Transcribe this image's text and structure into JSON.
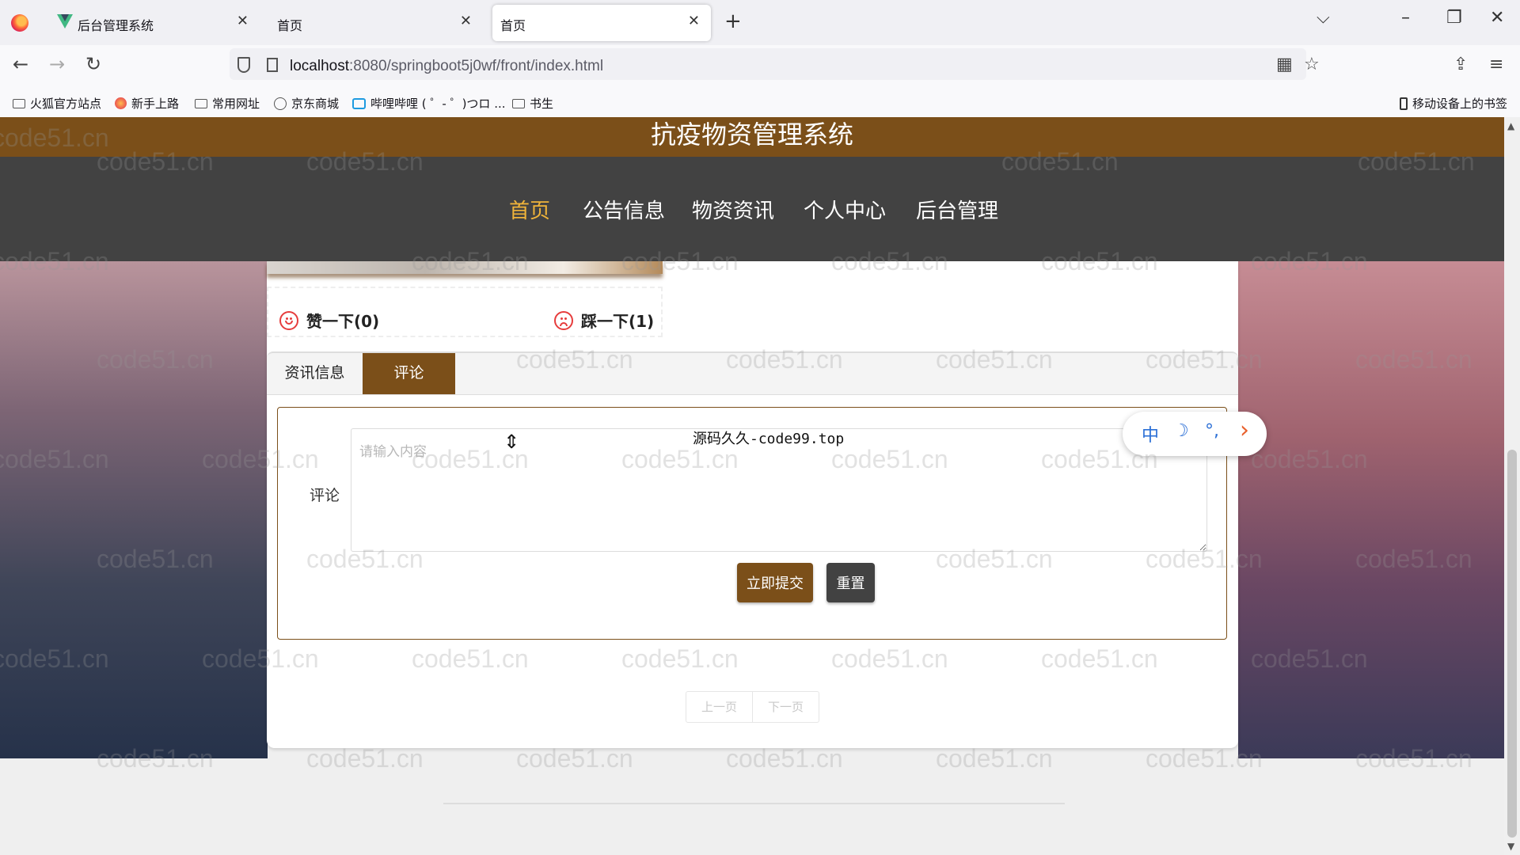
{
  "browser": {
    "tabs": [
      {
        "label": "后台管理系统",
        "icon": "vue-icon"
      },
      {
        "label": "首页"
      },
      {
        "label": "首页",
        "active": true
      }
    ],
    "url_host": "localhost",
    "url_path": ":8080/springboot5j0wf/front/index.html",
    "bookmarks": [
      "火狐官方站点",
      "新手上路",
      "常用网址",
      "京东商城",
      "哔哩哔哩 ( ゜- ゜)つロ ...",
      "书生"
    ],
    "mobile_bookmarks": "移动设备上的书签"
  },
  "site": {
    "title": "抗疫物资管理系统",
    "menu": [
      "首页",
      "公告信息",
      "物资资讯",
      "个人中心",
      "后台管理"
    ],
    "active_menu": "首页",
    "brand_color": "#7b4f19",
    "menu_active_color": "#f0b43a"
  },
  "votes": {
    "like": "赞一下(0)",
    "dislike": "踩一下(1)"
  },
  "tabs": {
    "info": "资讯信息",
    "comment": "评论"
  },
  "form": {
    "label": "评论",
    "placeholder": "请输入内容",
    "value": "",
    "submit": "立即提交",
    "reset": "重置"
  },
  "pager": {
    "prev": "上一页",
    "next": "下一页"
  },
  "overlay": {
    "source_text": "源码久久-code99.top",
    "ime": [
      "中",
      "☽",
      "°,",
      "›"
    ]
  },
  "watermark": "code51.cn"
}
